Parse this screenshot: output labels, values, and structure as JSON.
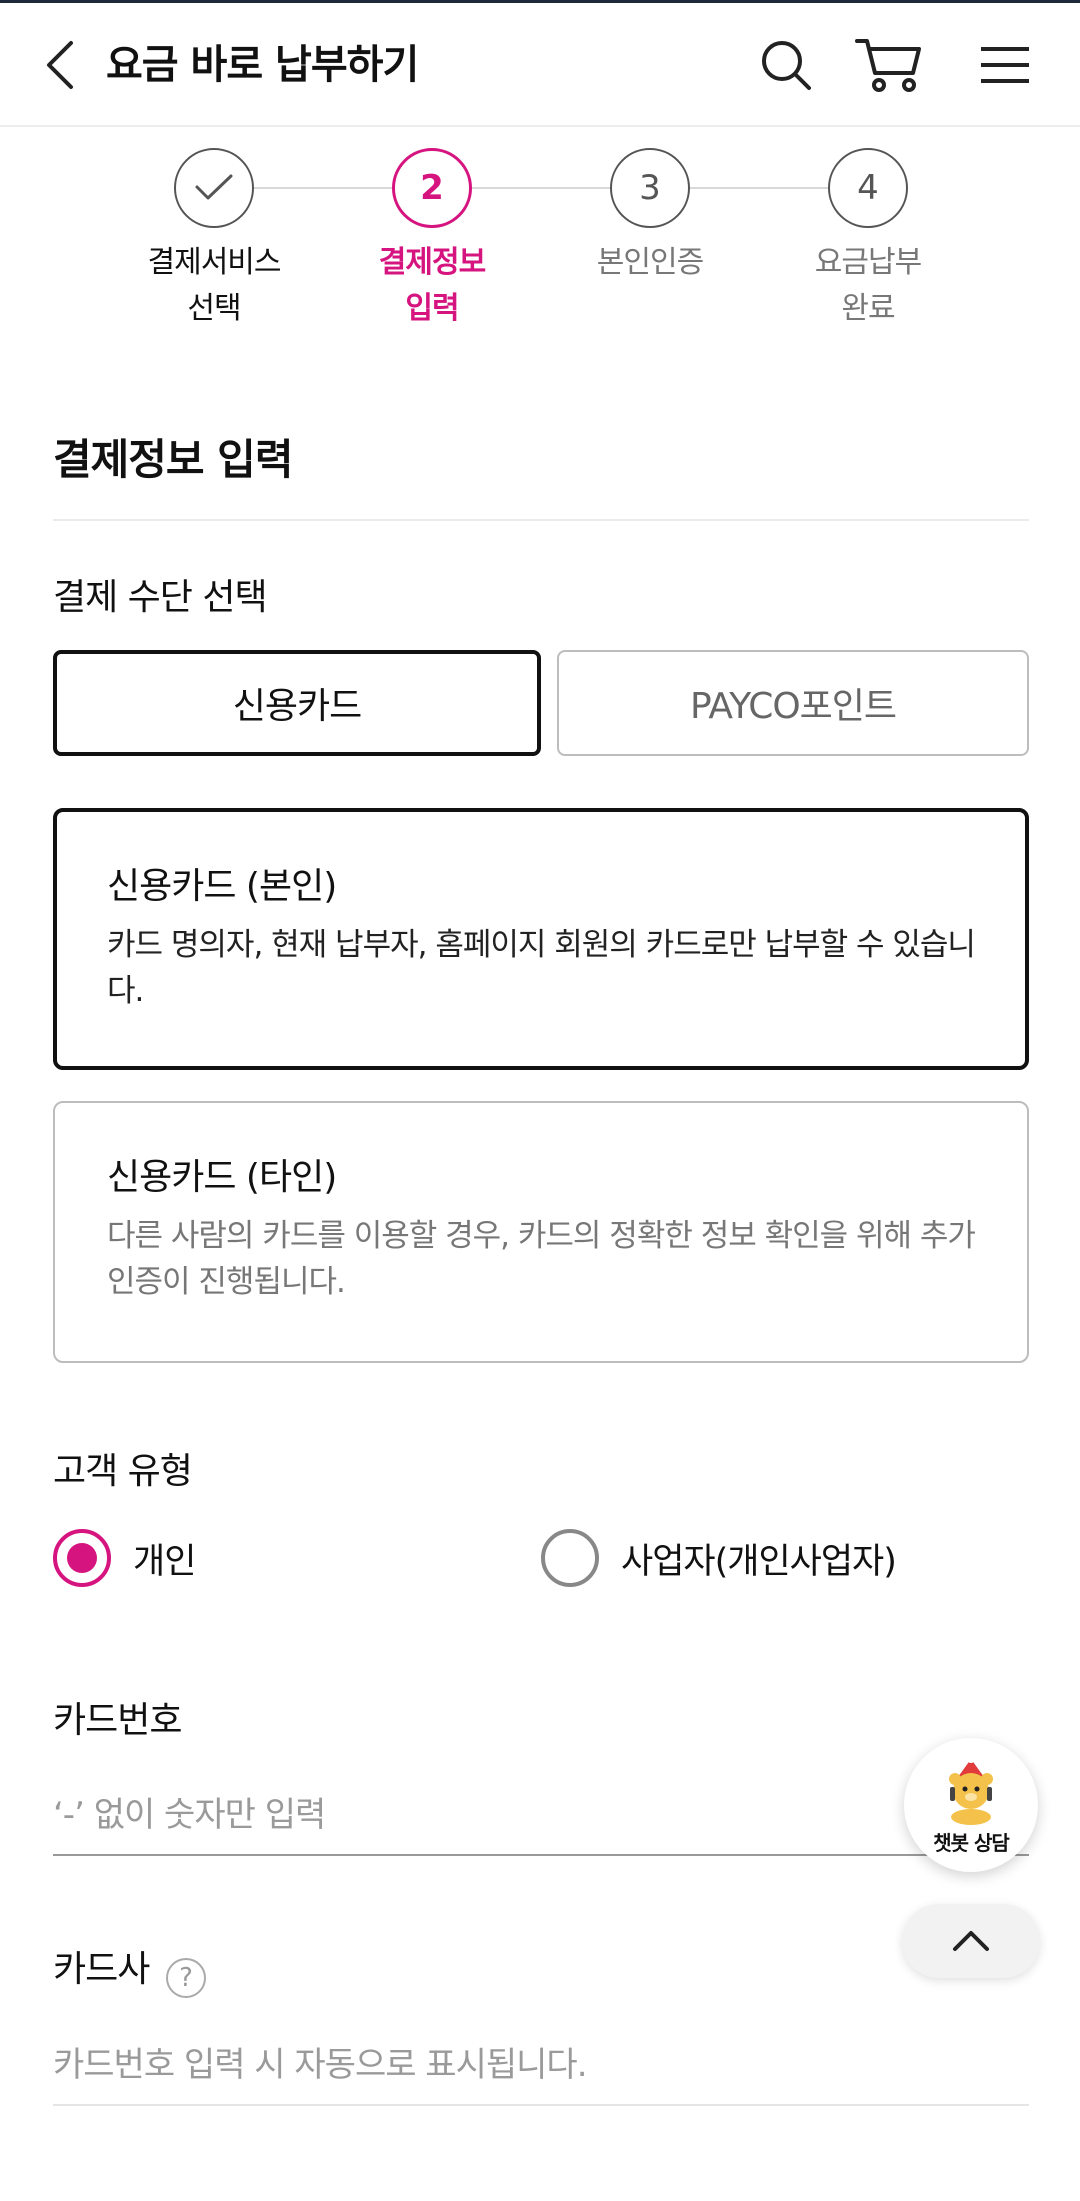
{
  "header": {
    "title": "요금 바로 납부하기",
    "back_icon": "chevron-left-icon",
    "search_icon": "search-icon",
    "cart_icon": "cart-icon",
    "menu_icon": "hamburger-menu-icon"
  },
  "stepper": {
    "accent_color": "#d6147f",
    "steps": [
      {
        "number": "",
        "label": "결제서비스\n선택",
        "state": "done"
      },
      {
        "number": "2",
        "label": "결제정보\n입력",
        "state": "active"
      },
      {
        "number": "3",
        "label": "본인인증",
        "state": "pending"
      },
      {
        "number": "4",
        "label": "요금납부\n완료",
        "state": "pending"
      }
    ]
  },
  "section": {
    "title": "결제정보 입력"
  },
  "payment_method": {
    "label": "결제 수단 선택",
    "options": [
      {
        "label": "신용카드",
        "selected": true
      },
      {
        "label": "PAYCO포인트",
        "selected": false
      }
    ]
  },
  "card_type": {
    "options": [
      {
        "title": "신용카드 (본인)",
        "description": "카드 명의자, 현재 납부자, 홈페이지 회원의 카드로만 납부할 수 있습니다.",
        "selected": true
      },
      {
        "title": "신용카드 (타인)",
        "description": "다른 사람의 카드를 이용할 경우, 카드의 정확한 정보 확인을 위해 추가 인증이 진행됩니다.",
        "selected": false
      }
    ]
  },
  "customer_type": {
    "label": "고객 유형",
    "options": [
      {
        "label": "개인",
        "checked": true
      },
      {
        "label": "사업자(개인사업자)",
        "checked": false
      }
    ]
  },
  "card_number": {
    "label": "카드번호",
    "value": "",
    "placeholder": "‘-’ 없이 숫자만 입력"
  },
  "card_company": {
    "label": "카드사",
    "help": "?",
    "value": "",
    "placeholder": "카드번호 입력 시 자동으로 표시됩니다."
  },
  "floating": {
    "chatbot_label": "챗봇 상담",
    "chatbot_icon": "chatbot-bear-icon",
    "top_icon": "chevron-up-icon"
  }
}
